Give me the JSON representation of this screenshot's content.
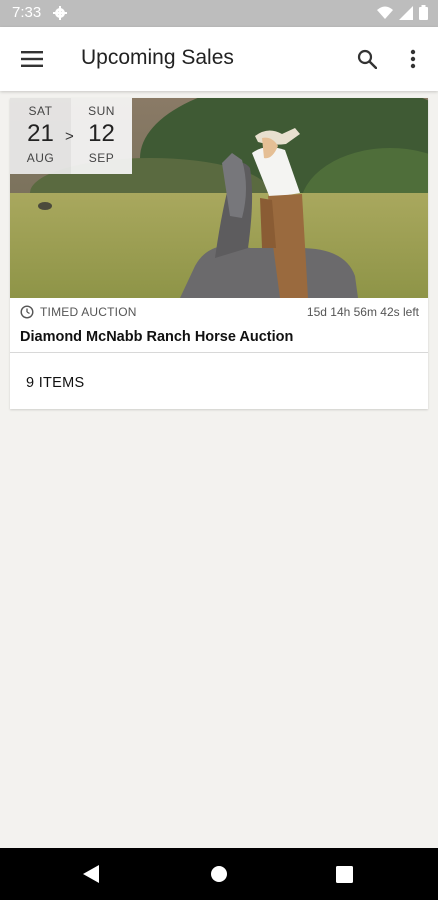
{
  "status_bar": {
    "time": "7:33"
  },
  "app_bar": {
    "title": "Upcoming Sales"
  },
  "sale": {
    "start": {
      "dow": "SAT",
      "day": "21",
      "month": "AUG"
    },
    "arrow": ">",
    "end": {
      "dow": "SUN",
      "day": "12",
      "month": "SEP"
    },
    "type": "TIMED AUCTION",
    "countdown": "15d 14h 56m 42s left",
    "name": "Diamond McNabb Ranch Horse Auction",
    "items": "9 ITEMS"
  },
  "colors": {
    "background": "#f3f2ef",
    "status_bar": "#bdbdbd",
    "nav_bar": "#000000"
  }
}
